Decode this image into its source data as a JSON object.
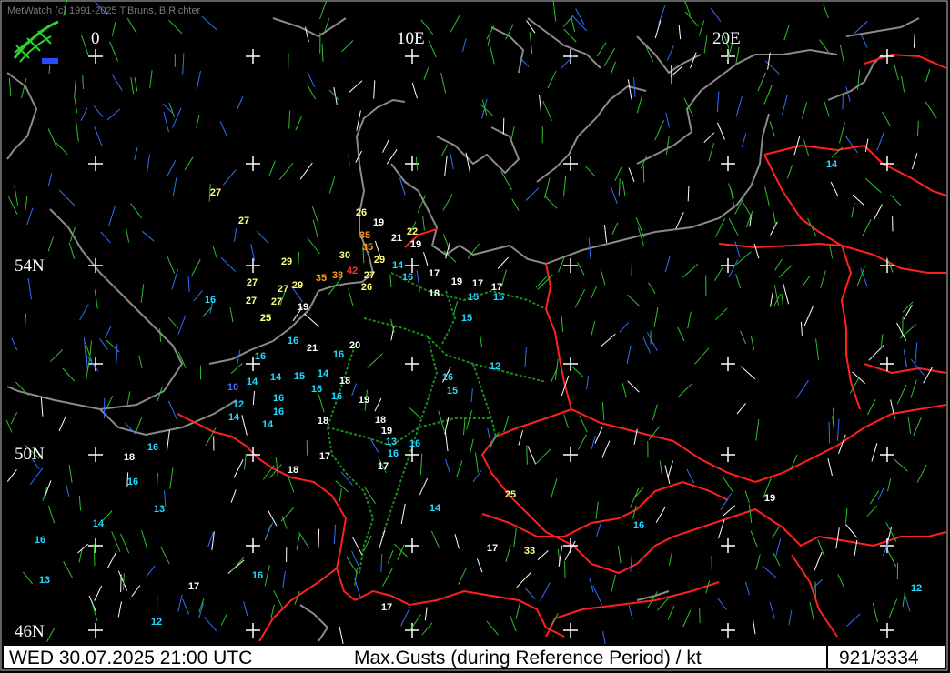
{
  "header": {
    "copyright": "MetWatch  (c) 1991-2025 T.Bruns, B.Richter"
  },
  "grid_labels": {
    "lon_0": "0",
    "lon_10e": "10E",
    "lon_20e": "20E",
    "lat_54n": "54N",
    "lat_50n": "50N",
    "lat_46n": "46N"
  },
  "status": {
    "datetime": "WED 30.07.2025 21:00 UTC",
    "product": "Max.Gusts (during Reference Period) / kt",
    "counter": "921/3334"
  },
  "colors": {
    "background": "#000000",
    "coast": "#8a8a8a",
    "border": "#ff2020",
    "german_states": "#1e8c1e",
    "gust_white": "#ffffff",
    "gust_cyan": "#22d8ff",
    "gust_yellow": "#ffff80",
    "gust_orange": "#ff9a20",
    "gust_red": "#ff3030",
    "gust_blue": "#4a6cff",
    "barb_green": "#30c030",
    "barb_blue": "#3070ff",
    "barb_white": "#ffffff"
  },
  "gust_observations": [
    {
      "value": "27",
      "color": "yellow"
    },
    {
      "value": "27",
      "color": "yellow"
    },
    {
      "value": "26",
      "color": "yellow"
    },
    {
      "value": "19",
      "color": "white"
    },
    {
      "value": "35",
      "color": "orange"
    },
    {
      "value": "22",
      "color": "yellow"
    },
    {
      "value": "35",
      "color": "orange"
    },
    {
      "value": "21",
      "color": "white"
    },
    {
      "value": "19",
      "color": "white"
    },
    {
      "value": "29",
      "color": "yellow"
    },
    {
      "value": "30",
      "color": "yellow"
    },
    {
      "value": "29",
      "color": "yellow"
    },
    {
      "value": "14",
      "color": "cyan"
    },
    {
      "value": "27",
      "color": "yellow"
    },
    {
      "value": "35",
      "color": "orange"
    },
    {
      "value": "38",
      "color": "orange"
    },
    {
      "value": "42",
      "color": "red"
    },
    {
      "value": "27",
      "color": "yellow"
    },
    {
      "value": "16",
      "color": "cyan"
    },
    {
      "value": "17",
      "color": "white"
    },
    {
      "value": "27",
      "color": "yellow"
    },
    {
      "value": "29",
      "color": "yellow"
    },
    {
      "value": "26",
      "color": "yellow"
    },
    {
      "value": "18",
      "color": "white"
    },
    {
      "value": "19",
      "color": "white"
    },
    {
      "value": "17",
      "color": "white"
    },
    {
      "value": "17",
      "color": "white"
    },
    {
      "value": "27",
      "color": "yellow"
    },
    {
      "value": "25",
      "color": "yellow"
    },
    {
      "value": "19",
      "color": "white"
    },
    {
      "value": "15",
      "color": "cyan"
    },
    {
      "value": "15",
      "color": "cyan"
    },
    {
      "value": "16",
      "color": "cyan"
    },
    {
      "value": "27",
      "color": "yellow"
    },
    {
      "value": "25",
      "color": "yellow"
    },
    {
      "value": "15",
      "color": "cyan"
    },
    {
      "value": "16",
      "color": "cyan"
    },
    {
      "value": "21",
      "color": "white"
    },
    {
      "value": "20",
      "color": "white"
    },
    {
      "value": "16",
      "color": "cyan"
    },
    {
      "value": "16",
      "color": "cyan"
    },
    {
      "value": "12",
      "color": "cyan"
    },
    {
      "value": "14",
      "color": "cyan"
    },
    {
      "value": "15",
      "color": "cyan"
    },
    {
      "value": "14",
      "color": "cyan"
    },
    {
      "value": "18",
      "color": "white"
    },
    {
      "value": "16",
      "color": "cyan"
    },
    {
      "value": "10",
      "color": "blue"
    },
    {
      "value": "14",
      "color": "cyan"
    },
    {
      "value": "16",
      "color": "cyan"
    },
    {
      "value": "16",
      "color": "cyan"
    },
    {
      "value": "19",
      "color": "white"
    },
    {
      "value": "15",
      "color": "cyan"
    },
    {
      "value": "16",
      "color": "cyan"
    },
    {
      "value": "12",
      "color": "cyan"
    },
    {
      "value": "16",
      "color": "cyan"
    },
    {
      "value": "14",
      "color": "cyan"
    },
    {
      "value": "14",
      "color": "cyan"
    },
    {
      "value": "18",
      "color": "white"
    },
    {
      "value": "18",
      "color": "white"
    },
    {
      "value": "19",
      "color": "white"
    },
    {
      "value": "13",
      "color": "cyan"
    },
    {
      "value": "16",
      "color": "cyan"
    },
    {
      "value": "16",
      "color": "cyan"
    },
    {
      "value": "18",
      "color": "white"
    },
    {
      "value": "16",
      "color": "cyan"
    },
    {
      "value": "17",
      "color": "white"
    },
    {
      "value": "17",
      "color": "white"
    },
    {
      "value": "18",
      "color": "white"
    },
    {
      "value": "16",
      "color": "cyan"
    },
    {
      "value": "13",
      "color": "cyan"
    },
    {
      "value": "25",
      "color": "yellow"
    },
    {
      "value": "19",
      "color": "white"
    },
    {
      "value": "14",
      "color": "cyan"
    },
    {
      "value": "14",
      "color": "cyan"
    },
    {
      "value": "16",
      "color": "cyan"
    },
    {
      "value": "17",
      "color": "white"
    },
    {
      "value": "33",
      "color": "yellow"
    },
    {
      "value": "16",
      "color": "cyan"
    },
    {
      "value": "13",
      "color": "cyan"
    },
    {
      "value": "17",
      "color": "white"
    },
    {
      "value": "16",
      "color": "cyan"
    },
    {
      "value": "17",
      "color": "white"
    },
    {
      "value": "12",
      "color": "cyan"
    },
    {
      "value": "12",
      "color": "cyan"
    },
    {
      "value": "14",
      "color": "cyan"
    }
  ]
}
